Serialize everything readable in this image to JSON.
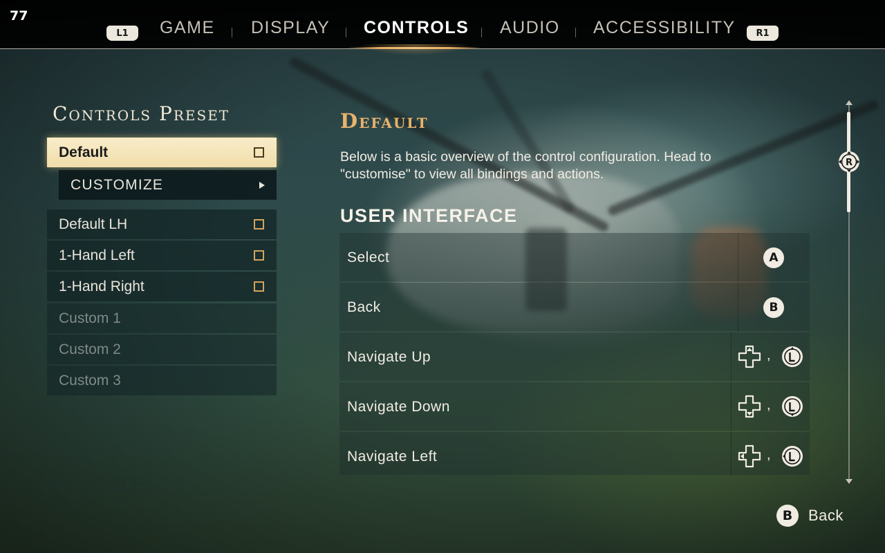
{
  "hud": {
    "fps": "77"
  },
  "bumpers": {
    "left": "L1",
    "right": "R1"
  },
  "tabs": [
    {
      "label": "GAME",
      "active": false
    },
    {
      "label": "DISPLAY",
      "active": false
    },
    {
      "label": "CONTROLS",
      "active": true
    },
    {
      "label": "AUDIO",
      "active": false
    },
    {
      "label": "ACCESSIBILITY",
      "active": false
    }
  ],
  "preset_panel": {
    "title": "Controls Preset",
    "items": [
      {
        "label": "Default",
        "state": "selected",
        "checkbox": true
      },
      {
        "label": "CUSTOMIZE",
        "state": "submenu",
        "checkbox": false
      },
      {
        "label": "Default LH",
        "state": "normal",
        "checkbox": true
      },
      {
        "label": "1-Hand Left",
        "state": "normal",
        "checkbox": true
      },
      {
        "label": "1-Hand Right",
        "state": "normal",
        "checkbox": true
      },
      {
        "label": "Custom 1",
        "state": "disabled",
        "checkbox": false
      },
      {
        "label": "Custom 2",
        "state": "disabled",
        "checkbox": false
      },
      {
        "label": "Custom 3",
        "state": "disabled",
        "checkbox": false
      }
    ]
  },
  "detail": {
    "heading": "Default",
    "description": "Below is a basic overview of the control configuration. Head to \"customise\" to view all bindings and actions.",
    "section": "USER INTERFACE",
    "bindings": [
      {
        "action": "Select",
        "buttons": [
          "A"
        ]
      },
      {
        "action": "Back",
        "buttons": [
          "B"
        ]
      },
      {
        "action": "Navigate Up",
        "buttons": [
          "dpad-up",
          "lstick-up"
        ],
        "separator": ","
      },
      {
        "action": "Navigate Down",
        "buttons": [
          "dpad-down",
          "lstick-down"
        ],
        "separator": ","
      },
      {
        "action": "Navigate Left",
        "buttons": [
          "dpad-left",
          "lstick-left"
        ],
        "separator": ","
      }
    ]
  },
  "scrollbar": {
    "stick": "R"
  },
  "footer": {
    "back_button": "B",
    "back_label": "Back"
  },
  "colors": {
    "accent": "#e8b36c",
    "selected_bg": "#f4e4b8",
    "checkbox": "#d6a45c"
  }
}
